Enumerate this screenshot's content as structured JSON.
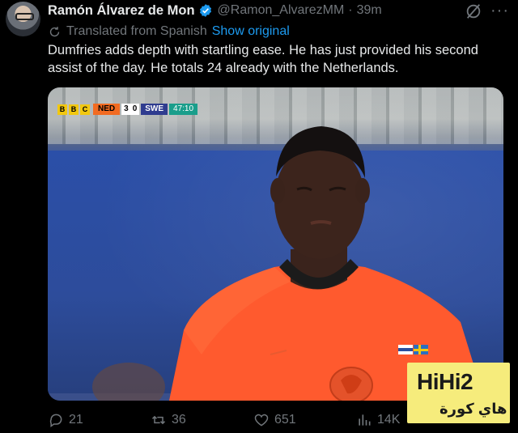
{
  "tweet": {
    "author_name": "Ramón Álvarez de Mon",
    "handle": "@Ramon_AlvarezMM",
    "separator": "·",
    "time": "39m",
    "translated_label": "Translated from Spanish",
    "show_original": "Show original",
    "text": "Dumfries adds depth with startling ease. He has just provided his second assist of the day. He totals 24 already with the Netherlands."
  },
  "scorebug": {
    "broadcaster": [
      "B",
      "B",
      "C"
    ],
    "home_team": "NED",
    "home_score": "3",
    "away_score": "0",
    "away_team": "SWE",
    "clock": "47:10"
  },
  "actions": {
    "replies": "21",
    "reposts": "36",
    "likes": "651",
    "views": "14K"
  },
  "watermark": {
    "logo": "HiHi2",
    "subtitle": "هاي كورة"
  },
  "colors": {
    "background": "#000000",
    "accent": "#1d9bf0",
    "muted": "#71767b",
    "jersey": "#ff5a2e"
  }
}
